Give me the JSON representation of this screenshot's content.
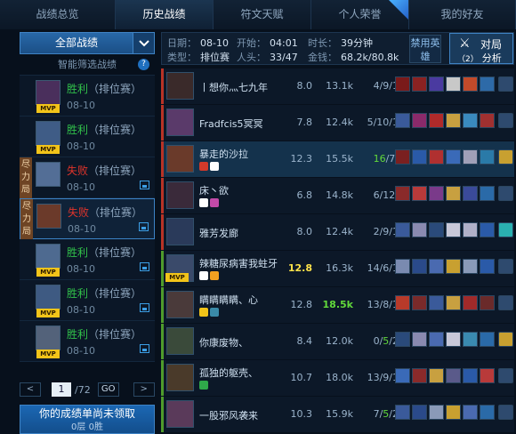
{
  "tabs": [
    {
      "label": "战绩总览",
      "active": false,
      "new": false
    },
    {
      "label": "历史战绩",
      "active": true,
      "new": false
    },
    {
      "label": "符文天赋",
      "active": false,
      "new": false
    },
    {
      "label": "个人荣誉",
      "active": false,
      "new": true
    },
    {
      "label": "我的好友",
      "active": false,
      "new": false
    }
  ],
  "new_badge": "NEW",
  "left": {
    "all_label": "全部战绩",
    "filter_label": "智能筛选战绩",
    "filter_help": "?",
    "matches": [
      {
        "result": "胜利",
        "type": "（排位赛）",
        "date": "08-10",
        "mvp": "MVP",
        "tag": "",
        "screenshot": false,
        "selected": false,
        "color": "#4a2f5c"
      },
      {
        "result": "胜利",
        "type": "（排位赛）",
        "date": "08-10",
        "mvp": "MVP",
        "tag": "",
        "screenshot": false,
        "selected": false,
        "color": "#3f5c86"
      },
      {
        "result": "失败",
        "type": "（排位赛）",
        "date": "08-10",
        "mvp": "",
        "tag": "尽力局",
        "screenshot": true,
        "selected": false,
        "color": "#536e96"
      },
      {
        "result": "失败",
        "type": "（排位赛）",
        "date": "08-10",
        "mvp": "",
        "tag": "尽力局",
        "screenshot": true,
        "selected": true,
        "color": "#6b3a2a"
      },
      {
        "result": "胜利",
        "type": "（排位赛）",
        "date": "08-10",
        "mvp": "MVP",
        "tag": "",
        "screenshot": true,
        "selected": false,
        "color": "#4e6a90"
      },
      {
        "result": "胜利",
        "type": "（排位赛）",
        "date": "08-10",
        "mvp": "MVP",
        "tag": "",
        "screenshot": true,
        "selected": false,
        "color": "#3e5a82"
      },
      {
        "result": "胜利",
        "type": "（排位赛）",
        "date": "08-10",
        "mvp": "MVP",
        "tag": "",
        "screenshot": true,
        "selected": false,
        "color": "#53627a"
      }
    ],
    "pager": {
      "prev": "<",
      "page": "1",
      "total": "/72",
      "go": "GO",
      "next": ">"
    },
    "claim_title": "你的成绩单尚未领取",
    "claim_sub": "0层 0胜"
  },
  "summary": {
    "date_label": "日期：",
    "date": "08-10",
    "start_label": "开始：",
    "start": "04:01",
    "duration_label": "时长：",
    "duration": "39分钟",
    "type_label": "类型：",
    "type": "排位赛",
    "kills_label": "人头：",
    "kills": "33/47",
    "gold_label": "金钱：",
    "gold": "68.2k/80.8k",
    "ban_label": "禁用英雄",
    "analysis_line1": "对局",
    "analysis_line2": "分析",
    "analysis_count": "（2）"
  },
  "players": [
    {
      "name": "丨想你灬七九年",
      "score": "8.0",
      "gold": "13.1k",
      "kda_pre": "4/9/14",
      "kda_hi": "",
      "kda_post": "",
      "team": "lose",
      "me": false,
      "mvp": "",
      "score_hi": false,
      "gold_hi": false,
      "badges": [],
      "avatar": "#3a2a2a",
      "items": [
        "#7a1a1a",
        "#8a2222",
        "#4a3aa0",
        "#c8c8c8",
        "#c24a2a",
        "#2d6aa8",
        "#2e4a6e"
      ]
    },
    {
      "name": "Fradfcis5冥冥",
      "score": "7.8",
      "gold": "12.4k",
      "kda_pre": "5/10/13",
      "kda_hi": "",
      "kda_post": "",
      "team": "lose",
      "me": false,
      "mvp": "",
      "score_hi": false,
      "gold_hi": false,
      "badges": [],
      "avatar": "#5a3a6a",
      "items": [
        "#3a5a9a",
        "#8a2a6a",
        "#b02a2a",
        "#c8a040",
        "#3a8abf",
        "#a03030",
        "#2e4a6e"
      ]
    },
    {
      "name": "暴走的沙拉",
      "score": "12.3",
      "gold": "15.5k",
      "kda_pre": "",
      "kda_hi": "16",
      "kda_post": "/7/8",
      "team": "lose",
      "me": true,
      "mvp": "",
      "score_hi": false,
      "gold_hi": false,
      "badges": [
        "#d23a2a",
        "#ffffff"
      ],
      "avatar": "#6a3a2a",
      "items": [
        "#7a2020",
        "#2a5aa8",
        "#b03030",
        "#3a6ab8",
        "#a0a0b8",
        "#2a7aa8",
        "#c8a030"
      ]
    },
    {
      "name": "床丶欲",
      "score": "6.8",
      "gold": "14.8k",
      "kda_pre": "6/12/6",
      "kda_hi": "",
      "kda_post": "",
      "team": "lose",
      "me": false,
      "mvp": "",
      "score_hi": false,
      "gold_hi": false,
      "badges": [
        "#ffffff",
        "#c24aa8"
      ],
      "avatar": "#3a2a3a",
      "items": [
        "#8a2a2a",
        "#b83a3a",
        "#7a3a8a",
        "#c8a040",
        "#3a4a9a",
        "#2a6aa8",
        "#2e4a6e"
      ]
    },
    {
      "name": "雅芳发廊",
      "score": "8.0",
      "gold": "12.4k",
      "kda_pre": "2/9/12",
      "kda_hi": "",
      "kda_post": "",
      "team": "lose",
      "me": false,
      "mvp": "",
      "score_hi": false,
      "gold_hi": false,
      "badges": [],
      "avatar": "#2a3a5a",
      "items": [
        "#3a5a9a",
        "#8a8ab0",
        "#2a4a7a",
        "#c8c8d8",
        "#b0b0c8",
        "#2a5aa8",
        "#2ab0b0"
      ]
    },
    {
      "name": "辣糖尿病害我蛀牙",
      "score": "12.8",
      "gold": "16.3k",
      "kda_pre": "14/6/10",
      "kda_hi": "",
      "kda_post": "",
      "team": "win",
      "me": false,
      "mvp": "MVP",
      "score_hi": true,
      "gold_hi": false,
      "badges": [
        "#ffffff",
        "#f2a020"
      ],
      "avatar": "#3a4a6a",
      "items": [
        "#7a8ab0",
        "#2a4a8a",
        "#4a6ab0",
        "#c8a030",
        "#8a9ab8",
        "#2a5aa8",
        "#2e4a6e"
      ]
    },
    {
      "name": "瞒瞒瞒瞒、心",
      "score": "12.8",
      "gold": "18.5k",
      "kda_pre": "13/8/18",
      "kda_hi": "",
      "kda_post": "",
      "team": "win",
      "me": false,
      "mvp": "",
      "score_hi": false,
      "gold_hi": true,
      "badges": [
        "#f2c419",
        "#3a8aa8"
      ],
      "avatar": "#4a3a3a",
      "items": [
        "#b83a2a",
        "#7a2a2a",
        "#3a5a9a",
        "#c8a040",
        "#a02a2a",
        "#6a2a2a",
        "#2e4a6e"
      ]
    },
    {
      "name": "你康废物、",
      "score": "8.4",
      "gold": "12.0k",
      "kda_pre": "0/",
      "kda_hi": "5",
      "kda_post": "/23",
      "team": "win",
      "me": false,
      "mvp": "",
      "score_hi": false,
      "gold_hi": false,
      "badges": [],
      "avatar": "#3a4a3a",
      "items": [
        "#2a4a7a",
        "#8a8ab0",
        "#4a6ab0",
        "#c8c8d8",
        "#3a8ab0",
        "#2a6aa8",
        "#c8a030"
      ]
    },
    {
      "name": "孤独的躯壳、",
      "score": "10.7",
      "gold": "18.0k",
      "kda_pre": "13/9/17",
      "kda_hi": "",
      "kda_post": "",
      "team": "win",
      "me": false,
      "mvp": "",
      "score_hi": false,
      "gold_hi": false,
      "badges": [
        "#2fa84a"
      ],
      "avatar": "#4a3a2a",
      "items": [
        "#3a6ab8",
        "#8a2a2a",
        "#c8a040",
        "#5a5a8a",
        "#2a5aa8",
        "#b83a3a",
        "#2e4a6e"
      ]
    },
    {
      "name": "一股邪风袭来",
      "score": "10.3",
      "gold": "15.9k",
      "kda_pre": "7/",
      "kda_hi": "5",
      "kda_post": "/20",
      "team": "win",
      "me": false,
      "mvp": "",
      "score_hi": false,
      "gold_hi": false,
      "badges": [],
      "avatar": "#5a3a5a",
      "items": [
        "#3a5a9a",
        "#2a4a8a",
        "#8a9ab8",
        "#c8a030",
        "#4a6ab0",
        "#2a6aa8",
        "#2e4a6e"
      ]
    }
  ]
}
